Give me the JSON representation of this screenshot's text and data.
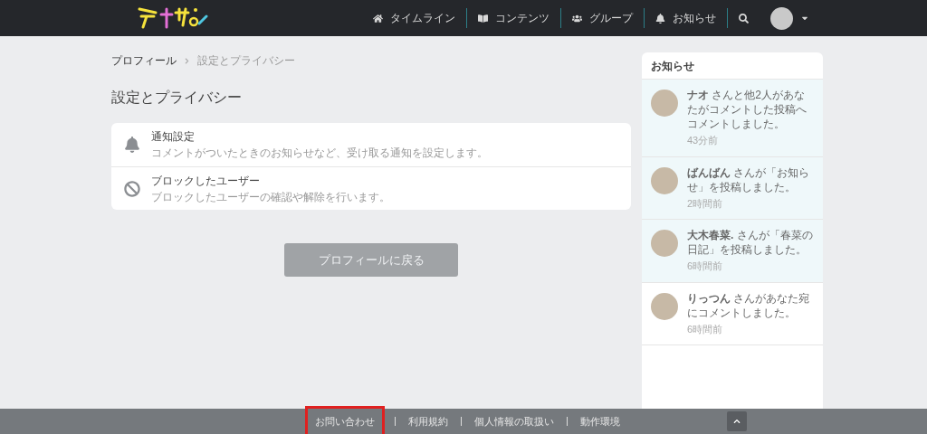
{
  "nav": {
    "items": [
      {
        "kind": "home",
        "label": "タイムライン"
      },
      {
        "kind": "book",
        "label": "コンテンツ"
      },
      {
        "kind": "users",
        "label": "グループ"
      },
      {
        "kind": "bell",
        "label": "お知らせ"
      }
    ]
  },
  "breadcrumb": [
    "プロフィール",
    "設定とプライバシー"
  ],
  "page_title": "設定とプライバシー",
  "settings": [
    {
      "kind": "bell",
      "title": "通知設定",
      "description": "コメントがついたときのお知らせなど、受け取る通知を設定します。"
    },
    {
      "kind": "block",
      "title": "ブロックしたユーザー",
      "description": "ブロックしたユーザーの確認や解除を行います。"
    }
  ],
  "back_button": "プロフィールに戻る",
  "notifications": {
    "title": "お知らせ",
    "items": [
      {
        "message": "**ナオ** さんと他2人があなたがコメントした投稿へコメントしました。",
        "time": "43分前",
        "unread": true
      },
      {
        "message": "**ばんばん** さんが「お知らせ」を投稿しました。",
        "time": "2時間前",
        "unread": true
      },
      {
        "message": "**大木春菜.** さんが「春菜の日記」を投稿しました。",
        "time": "6時間前",
        "unread": true
      },
      {
        "message": "**りっつん** さんがあなた宛にコメントしました。",
        "time": "6時間前",
        "unread": false
      }
    ]
  },
  "footer": {
    "links": [
      {
        "label": "お問い合わせ",
        "highlighted": true
      },
      {
        "label": "利用規約",
        "highlighted": false
      },
      {
        "label": "個人情報の取扱い",
        "highlighted": false
      },
      {
        "label": "動作環境",
        "highlighted": false
      }
    ]
  }
}
